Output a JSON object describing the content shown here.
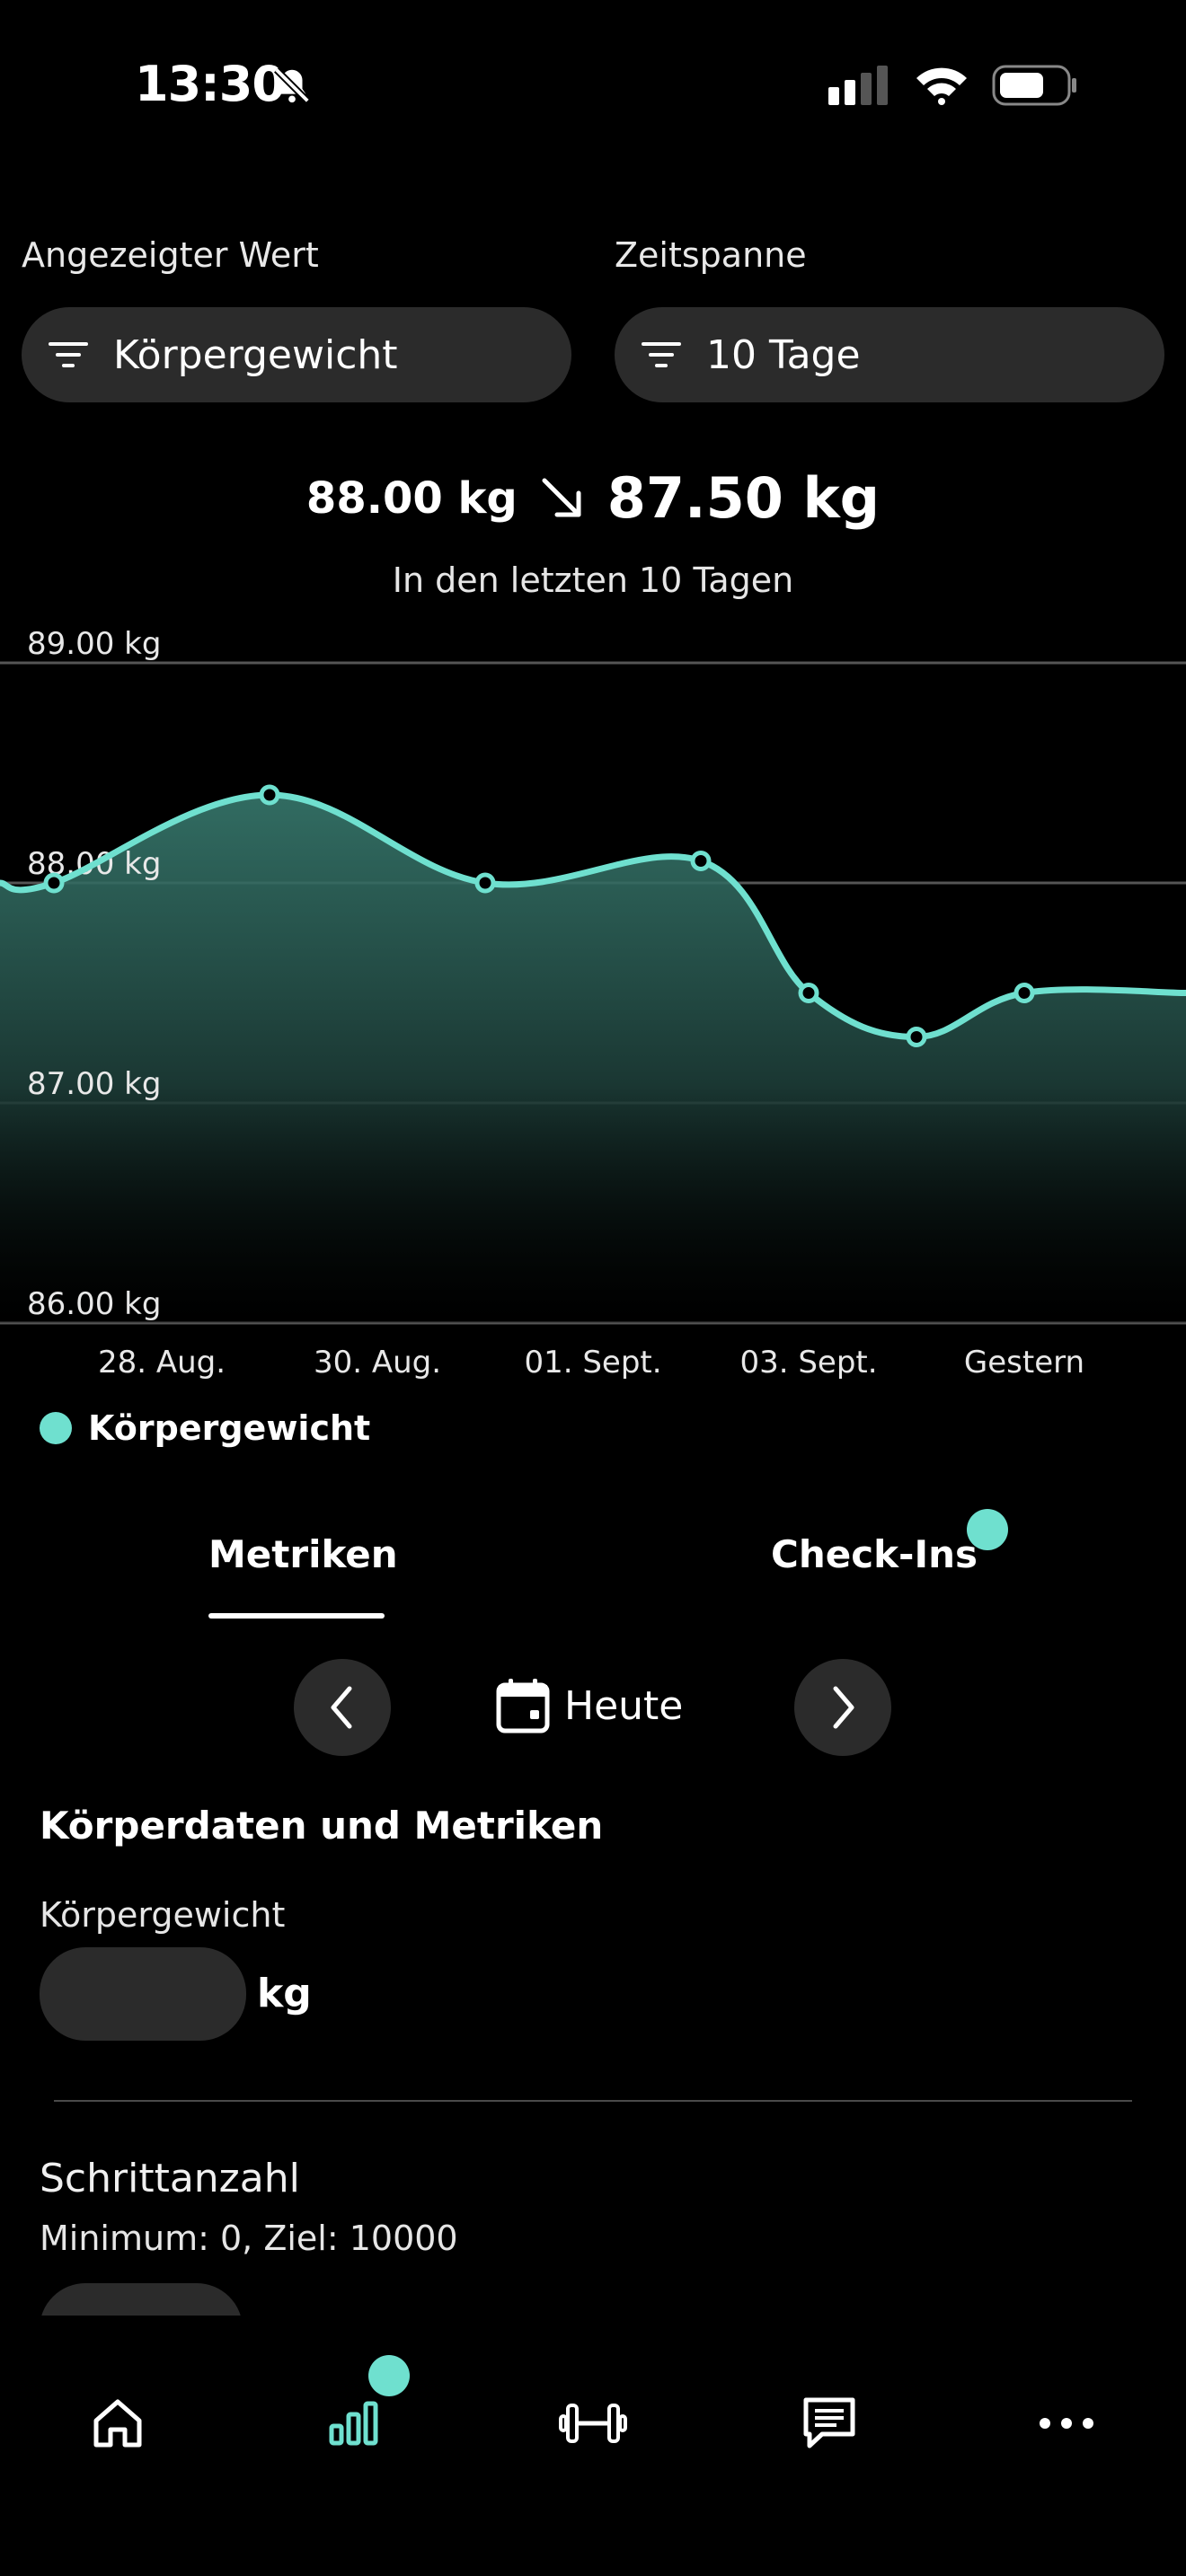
{
  "status_bar": {
    "time": "13:30"
  },
  "filters": {
    "metric_label": "Angezeigter Wert",
    "metric_value": "Körpergewicht",
    "range_label": "Zeitspanne",
    "range_value": "10 Tage"
  },
  "summary": {
    "start_value": "88.00 kg",
    "end_value": "87.50 kg",
    "subtitle": "In den letzten 10 Tagen"
  },
  "chart_data": {
    "type": "area",
    "y_ticks": [
      "89.00 kg",
      "88.00 kg",
      "87.00 kg",
      "86.00 kg"
    ],
    "ylim": [
      86,
      89
    ],
    "x_ticks": [
      "28. Aug.",
      "30. Aug.",
      "01. Sept.",
      "03. Sept.",
      "Gestern"
    ],
    "series": [
      {
        "name": "Körpergewicht",
        "x": [
          "28. Aug.",
          "29. Aug.",
          "31. Aug.",
          "02. Sept.",
          "03. Sept.",
          "04. Sept.",
          "Gestern"
        ],
        "values": [
          88.0,
          88.4,
          88.0,
          88.1,
          87.5,
          87.3,
          87.5
        ]
      }
    ],
    "color": "#6fe0cf",
    "grid": true
  },
  "legend": {
    "label": "Körpergewicht"
  },
  "tabs": {
    "metrics": "Metriken",
    "checkins": "Check-Ins"
  },
  "date_nav": {
    "label": "Heute"
  },
  "body_metrics": {
    "title": "Körperdaten und Metriken",
    "weight_label": "Körpergewicht",
    "weight_value": "",
    "weight_unit": "kg",
    "steps_label": "Schrittanzahl",
    "steps_hint": "Minimum: 0, Ziel: 10000"
  },
  "bottom_nav": [
    "home-icon",
    "stats-icon",
    "dumbbell-icon",
    "chat-icon",
    "more-icon"
  ]
}
